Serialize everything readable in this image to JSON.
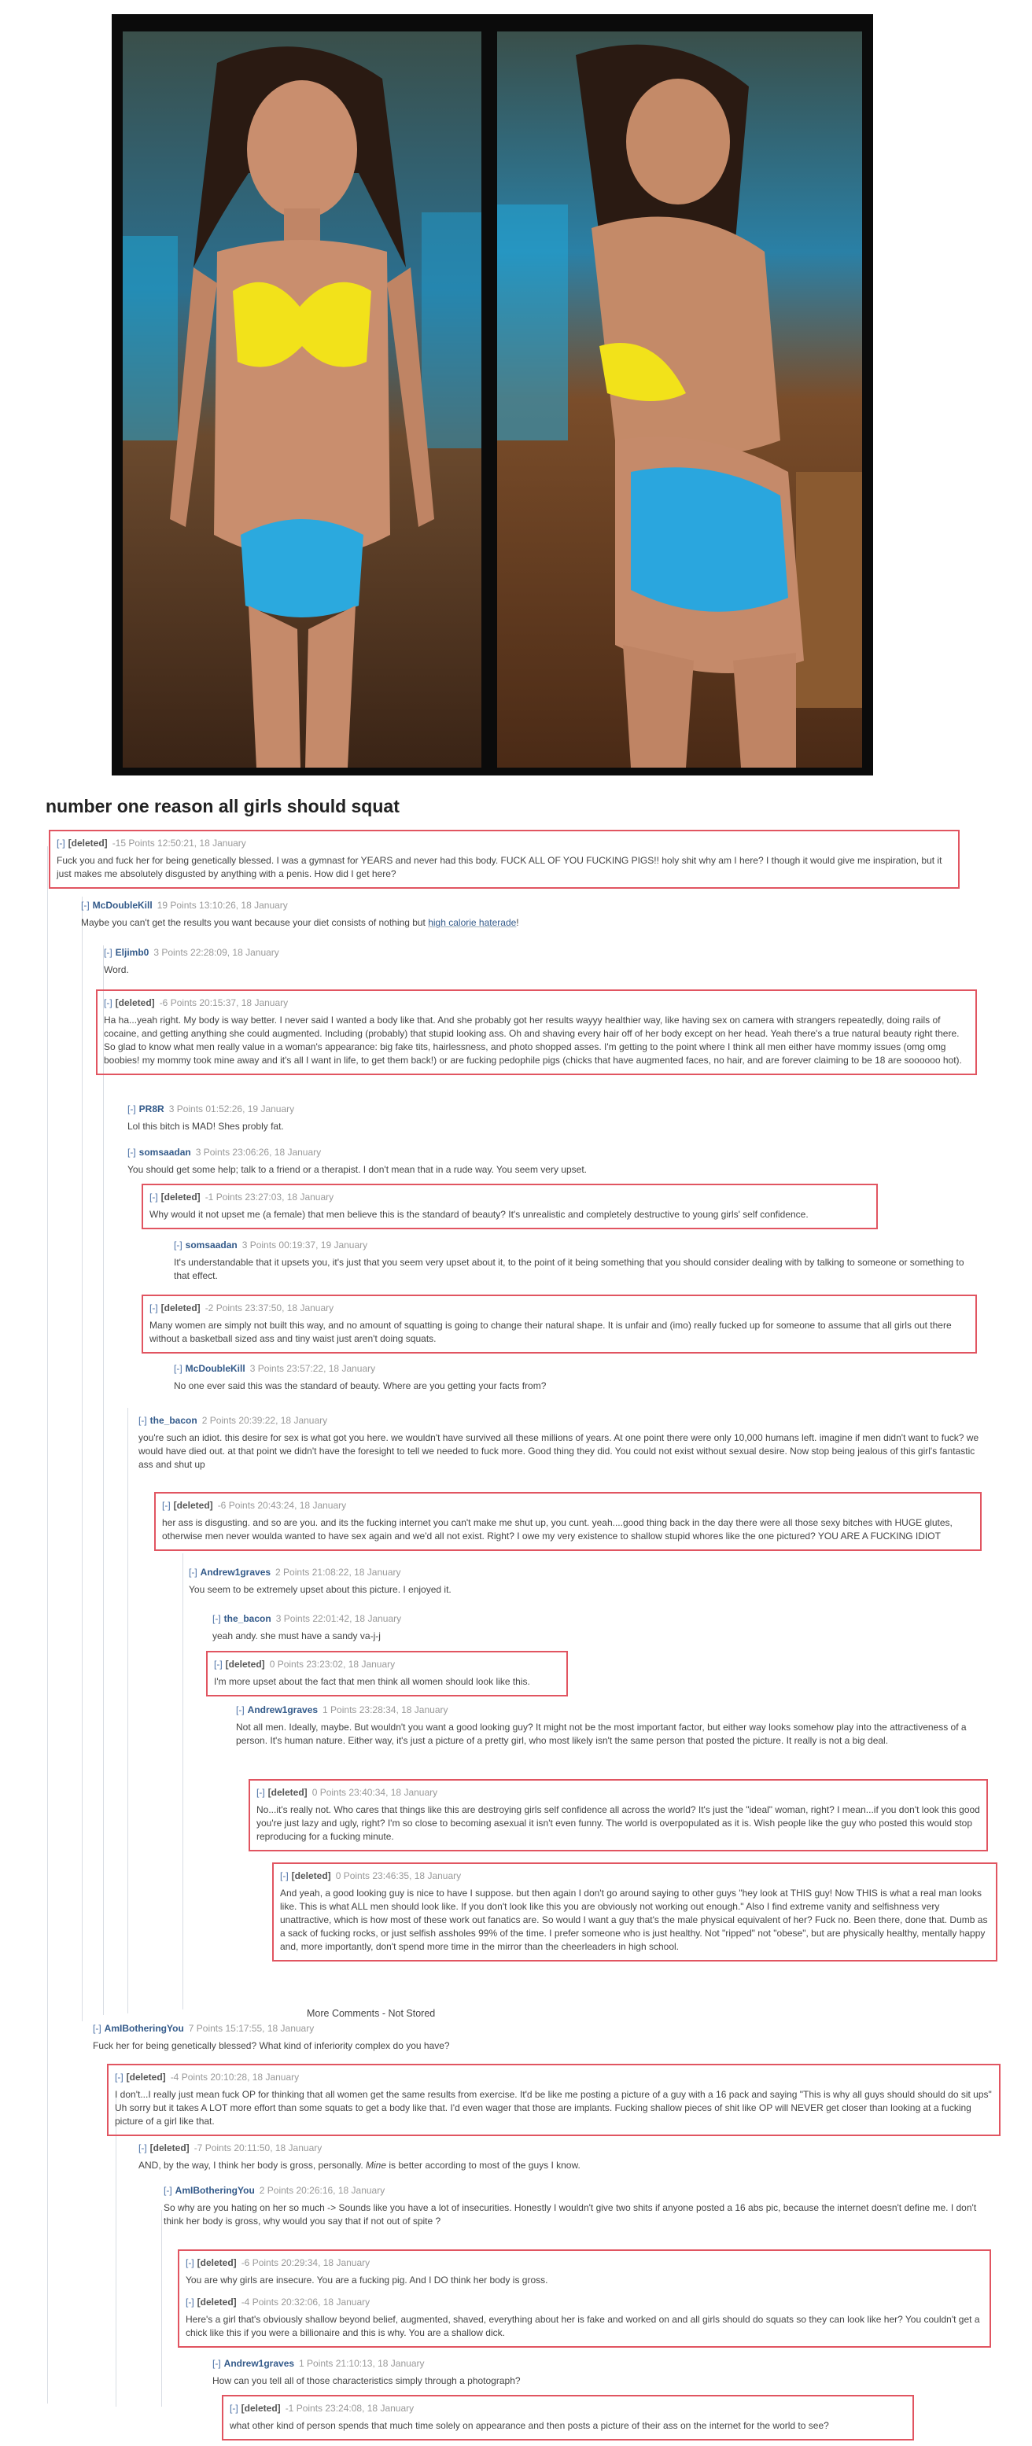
{
  "post": {
    "title": "number one reason all girls should squat"
  },
  "toggle": "[-]",
  "comments": [
    {
      "id": "c1",
      "author": "[deleted]",
      "meta": "-15 Points 12:50:21, 18 January",
      "text": "Fuck you and fuck her for being genetically blessed. I was a gymnast for YEARS and never had this body. FUCK ALL OF YOU FUCKING PIGS!! holy shit why am I here? I though it would give me inspiration, but it just makes me absolutely disgusted by anything with a penis. How did I get here?"
    },
    {
      "id": "c2",
      "author": "McDoubleKill",
      "meta": "19 Points 13:10:26, 18 January",
      "text": "Maybe you can't get the results you want because your diet consists of nothing but ",
      "link": "high calorie haterade",
      "text_after": "!"
    },
    {
      "id": "c3",
      "author": "Eljimb0",
      "meta": "3 Points 22:28:09, 18 January",
      "text": "Word."
    },
    {
      "id": "c4",
      "author": "[deleted]",
      "meta": "-6 Points 20:15:37, 18 January",
      "text": "Ha ha...yeah right. My body is way better. I never said I wanted a body like that. And she probably got her results wayyy healthier way, like having sex on camera with strangers repeatedly, doing rails of cocaine, and getting anything she could augmented. Including (probably) that stupid looking ass. Oh and shaving every hair off of her body except on her head. Yeah there's a true natural beauty right there. So glad to know what men really value in a woman's appearance: big fake tits, hairlessness, and photo shopped asses. I'm getting to the point where I think all men either have mommy issues (omg omg boobies! my mommy took mine away and it's all I want in life, to get them back!) or are fucking pedophile pigs (chicks that have augmented faces, no hair, and are forever claiming to be 18 are soooooo hot)."
    },
    {
      "id": "c5",
      "author": "PR8R",
      "meta": "3 Points 01:52:26, 19 January",
      "text": "Lol this bitch is MAD! Shes probly fat."
    },
    {
      "id": "c6",
      "author": "somsaadan",
      "meta": "3 Points 23:06:26, 18 January",
      "text": "You should get some help; talk to a friend or a therapist. I don't mean that in a rude way. You seem very upset."
    },
    {
      "id": "c7",
      "author": "[deleted]",
      "meta": "-1 Points 23:27:03, 18 January",
      "text": "Why would it not upset me (a female) that men believe this is the standard of beauty? It's unrealistic and completely destructive to young girls' self confidence."
    },
    {
      "id": "c8",
      "author": "somsaadan",
      "meta": "3 Points 00:19:37, 19 January",
      "text": "It's understandable that it upsets you, it's just that you seem very upset about it, to the point of it being something that you should consider dealing with by talking to someone or something to that effect."
    },
    {
      "id": "c9",
      "author": "[deleted]",
      "meta": "-2 Points 23:37:50, 18 January",
      "text": "Many women are simply not built this way, and no amount of squatting is going to change their natural shape. It is unfair and (imo) really fucked up for someone to assume that all girls out there without a basketball sized ass and tiny waist just aren't doing squats."
    },
    {
      "id": "c10",
      "author": "McDoubleKill",
      "meta": "3 Points 23:57:22, 18 January",
      "text": "No one ever said this was the standard of beauty. Where are you getting your facts from?"
    },
    {
      "id": "c11",
      "author": "the_bacon",
      "meta": "2 Points 20:39:22, 18 January",
      "text": "you're such an idiot. this desire for sex is what got you here. we wouldn't have survived all these millions of years. At one point there were only 10,000 humans left. imagine if men didn't want to fuck? we would have died out. at that point we didn't have the foresight to tell we needed to fuck more. Good thing they did. You could not exist without sexual desire. Now stop being jealous of this girl's fantastic ass and shut up"
    },
    {
      "id": "c12",
      "author": "[deleted]",
      "meta": "-6 Points 20:43:24, 18 January",
      "text": "her ass is disgusting. and so are you. and its the fucking internet you can't make me shut up, you cunt. yeah....good thing back in the day there were all those sexy bitches with HUGE glutes, otherwise men never woulda wanted to have sex again and we'd all not exist. Right? I owe my very existence to shallow stupid whores like the one pictured? YOU ARE A FUCKING IDIOT"
    },
    {
      "id": "c13",
      "author": "Andrew1graves",
      "meta": "2 Points 21:08:22, 18 January",
      "text": "You seem to be extremely upset about this picture. I enjoyed it."
    },
    {
      "id": "c14",
      "author": "the_bacon",
      "meta": "3 Points 22:01:42, 18 January",
      "text": "yeah andy. she must have a sandy va-j-j"
    },
    {
      "id": "c15",
      "author": "[deleted]",
      "meta": "0 Points 23:23:02, 18 January",
      "text": "I'm more upset about the fact that men think all women should look like this."
    },
    {
      "id": "c16",
      "author": "Andrew1graves",
      "meta": "1 Points 23:28:34, 18 January",
      "text": "Not all men. Ideally, maybe. But wouldn't you want a good looking guy? It might not be the most important factor, but either way looks somehow play into the attractiveness of a person. It's human nature. Either way, it's just a picture of a pretty girl, who most likely isn't the same person that posted the picture. It really is not a big deal."
    },
    {
      "id": "c17",
      "author": "[deleted]",
      "meta": "0 Points 23:40:34, 18 January",
      "text": "No...it's really not. Who cares that things like this are destroying girls self confidence all across the world? It's just the \"ideal\" woman, right? I mean...if you don't look this good you're just lazy and ugly, right? I'm so close to becoming asexual it isn't even funny. The world is overpopulated as it is. Wish people like the guy who posted this would stop reproducing for a fucking minute."
    },
    {
      "id": "c18",
      "author": "[deleted]",
      "meta": "0 Points 23:46:35, 18 January",
      "text": "And yeah, a good looking guy is nice to have I suppose. but then again I don't go around saying to other guys \"hey look at THIS guy! Now THIS is what a real man looks like. This is what ALL men should look like. If you don't look like this you are obviously not working out enough.\" Also I find extreme vanity and selfishness very unattractive, which is how most of these work out fanatics are. So would I want a guy that's the male physical equivalent of her? Fuck no. Been there, done that. Dumb as a sack of fucking rocks, or just selfish assholes 99% of the time. I prefer someone who is just healthy. Not \"ripped\" not \"obese\", but are physically healthy, mentally happy and, more importantly, don't spend more time in the mirror than the cheerleaders in high school."
    },
    {
      "id": "c19",
      "author": "AmIBotheringYou",
      "meta": "7 Points 15:17:55, 18 January",
      "text": "Fuck her for being genetically blessed? What kind of inferiority complex do you have?"
    },
    {
      "id": "c20",
      "author": "[deleted]",
      "meta": "-4 Points 20:10:28, 18 January",
      "text": "I don't...I really just mean fuck OP for thinking that all women get the same results from exercise. It'd be like me posting a picture of a guy with a 16 pack and saying \"This is why all guys should should do sit ups\" Uh sorry but it takes A LOT more effort than some squats to get a body like that. I'd even wager that those are implants. Fucking shallow pieces of shit like OP will NEVER get closer than looking at a fucking picture of a girl like that."
    },
    {
      "id": "c21",
      "author": "[deleted]",
      "meta": "-7 Points 20:11:50, 18 January",
      "text": "AND, by the way, I think her body is gross, personally. ",
      "emph": "Mine",
      "text_after": " is better according to most of the guys I know."
    },
    {
      "id": "c22",
      "author": "AmIBotheringYou",
      "meta": "2 Points 20:26:16, 18 January",
      "text": "So why are you hating on her so much -> Sounds like you have a lot of insecurities. Honestly I wouldn't give two shits if anyone posted a 16 abs pic, because the internet doesn't define me. I don't think her body is gross, why would you say that if not out of spite ?"
    },
    {
      "id": "c23",
      "author": "[deleted]",
      "meta": "-6 Points 20:29:34, 18 January",
      "text": "You are why girls are insecure. You are a fucking pig. And I DO think her body is gross."
    },
    {
      "id": "c24",
      "author": "[deleted]",
      "meta": "-4 Points 20:32:06, 18 January",
      "text": "Here's a girl that's obviously shallow beyond belief, augmented, shaved, everything about her is fake and worked on and all girls should do squats so they can look like her? You couldn't get a chick like this if you were a billionaire and this is why. You are a shallow dick."
    },
    {
      "id": "c25",
      "author": "Andrew1graves",
      "meta": "1 Points 21:10:13, 18 January",
      "text": "How can you tell all of those characteristics simply through a photograph?"
    },
    {
      "id": "c26",
      "author": "[deleted]",
      "meta": "-1 Points 23:24:08, 18 January",
      "text": "what other kind of person spends that much time solely on appearance and then posts a picture of their ass on the internet for the world to see?"
    }
  ],
  "more_comments": "More Comments - Not Stored",
  "colors": {
    "highlight_border": "#e15561",
    "author_link": "#335a8a",
    "meta": "#999999"
  }
}
